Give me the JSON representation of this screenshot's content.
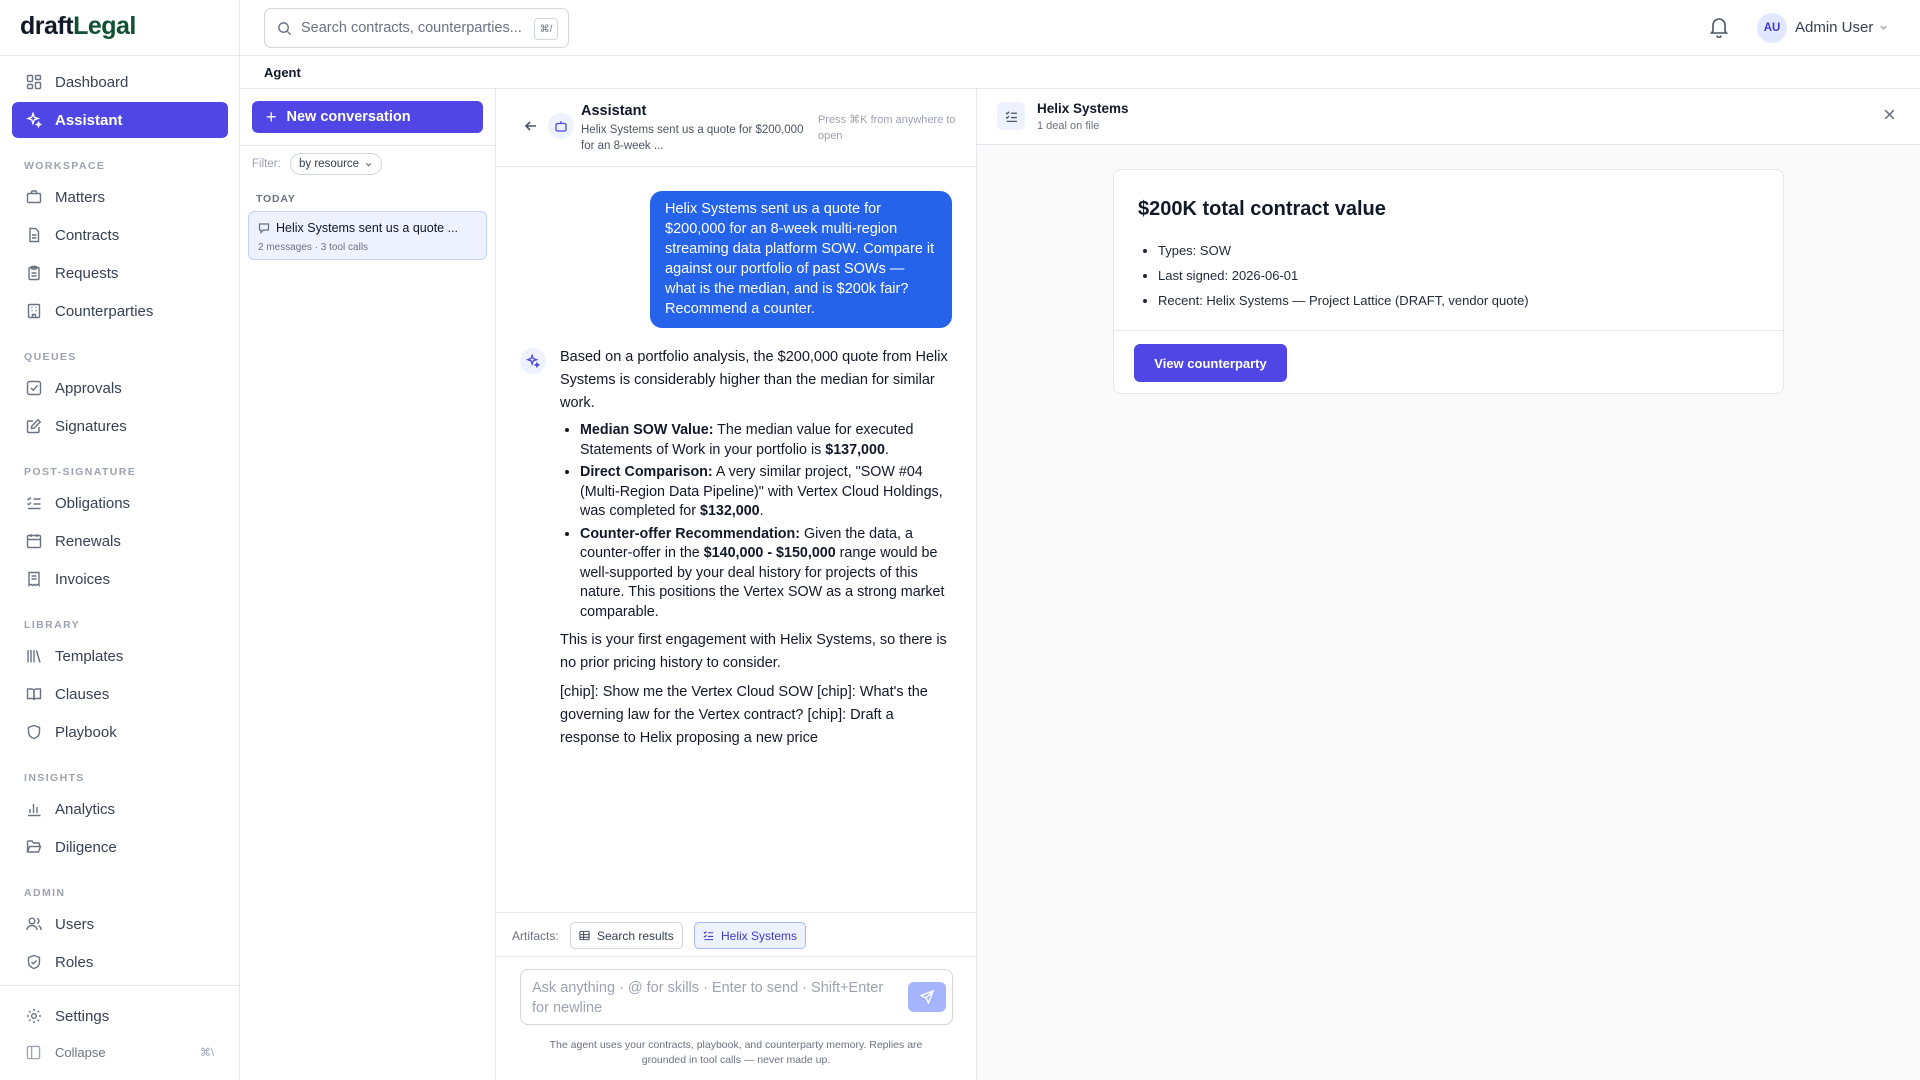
{
  "app": {
    "logo_prefix": "draft",
    "logo_suffix": "Legal"
  },
  "sidebar": {
    "primary": [
      {
        "label": "Dashboard",
        "icon": "dashboard-icon"
      },
      {
        "label": "Assistant",
        "icon": "sparkles-icon",
        "active": true
      }
    ],
    "sections": [
      {
        "title": "WORKSPACE",
        "items": [
          "Matters",
          "Contracts",
          "Requests",
          "Counterparties"
        ]
      },
      {
        "title": "QUEUES",
        "items": [
          "Approvals",
          "Signatures"
        ]
      },
      {
        "title": "POST-SIGNATURE",
        "items": [
          "Obligations",
          "Renewals",
          "Invoices"
        ]
      },
      {
        "title": "LIBRARY",
        "items": [
          "Templates",
          "Clauses",
          "Playbook"
        ]
      },
      {
        "title": "INSIGHTS",
        "items": [
          "Analytics",
          "Diligence"
        ]
      },
      {
        "title": "ADMIN",
        "items": [
          "Users",
          "Roles"
        ]
      }
    ],
    "settings_label": "Settings",
    "collapse_label": "Collapse",
    "collapse_shortcut": "⌘\\"
  },
  "topbar": {
    "search_placeholder": "Search contracts, counterparties...",
    "search_shortcut": "⌘/",
    "user_initials": "AU",
    "user_name": "Admin User"
  },
  "breadcrumb": "Agent",
  "conversations": {
    "new_label": "New conversation",
    "filter_label": "Filter:",
    "filter_value": "by resource",
    "group_label": "TODAY",
    "items": [
      {
        "title": "Helix Systems sent us a quote ...",
        "meta": "2 messages · 3 tool calls"
      }
    ]
  },
  "chat": {
    "title": "Assistant",
    "subtitle": "Helix Systems sent us a quote for $200,000 for an 8-week ...",
    "hint": "Press ⌘K from anywhere to open",
    "user_message": "Helix Systems sent us a quote for $200,000 for an 8-week multi-region streaming data platform SOW. Compare it against our portfolio of past SOWs — what is the median, and is $200k fair? Recommend a counter.",
    "ai_intro": "Based on a portfolio analysis, the $200,000 quote from Helix Systems is considerably higher than the median for similar work.",
    "bullets": [
      {
        "label": "Median SOW Value:",
        "text_before": " The median value for executed Statements of Work in your portfolio is ",
        "bold": "$137,000",
        "text_after": "."
      },
      {
        "label": "Direct Comparison:",
        "text_before": " A very similar project, \"SOW #04 (Multi-Region Data Pipeline)\" with Vertex Cloud Holdings, was completed for ",
        "bold": "$132,000",
        "text_after": "."
      },
      {
        "label": "Counter-offer Recommendation:",
        "text_before": " Given the data, a counter-offer in the ",
        "bold": "$140,000 - $150,000",
        "text_after": " range would be well-supported by your deal history for projects of this nature. This positions the Vertex SOW as a strong market comparable."
      }
    ],
    "ai_note": "This is your first engagement with Helix Systems, so there is no prior pricing history to consider.",
    "ai_chips": "[chip]: Show me the Vertex Cloud SOW [chip]: What's the governing law for the Vertex contract? [chip]: Draft a response to Helix proposing a new price",
    "artifacts_label": "Artifacts:",
    "artifacts": [
      "Search results",
      "Helix Systems"
    ],
    "composer_placeholder": "Ask anything · @ for skills · Enter to send · Shift+Enter for newline",
    "footnote": "The agent uses your contracts, playbook, and counterparty memory. Replies are grounded in tool calls — never made up."
  },
  "artifact": {
    "title": "Helix Systems",
    "subtitle": "1 deal on file",
    "card_title": "$200K total contract value",
    "facts": [
      "Types: SOW",
      "Last signed: 2026-06-01",
      "Recent: Helix Systems — Project Lattice (DRAFT, vendor quote)"
    ],
    "button_label": "View counterparty"
  },
  "colors": {
    "accent": "#4f46e5",
    "user_bubble": "#2563eb"
  }
}
